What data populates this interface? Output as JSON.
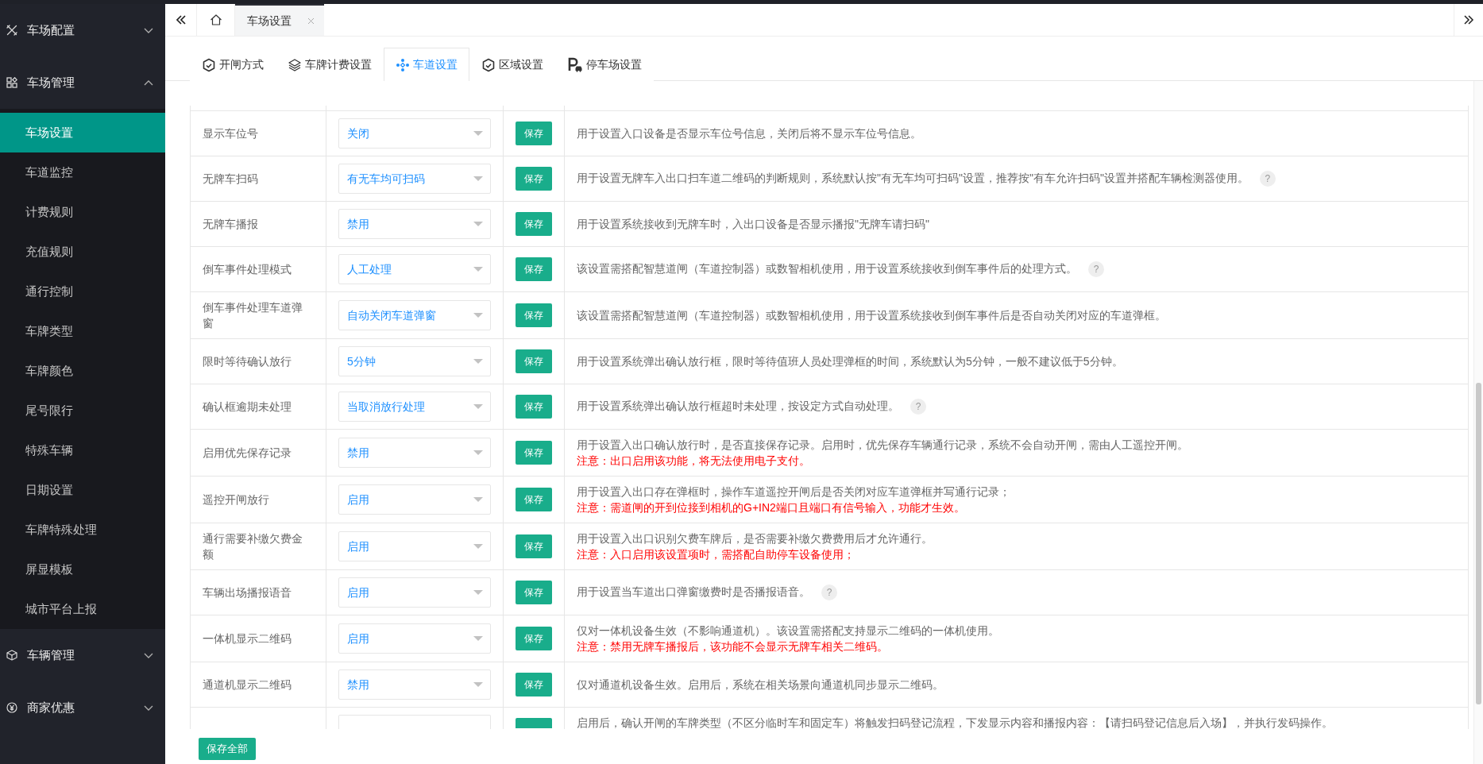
{
  "sidebar": {
    "items": [
      {
        "label": "车场配置",
        "expanded": false
      },
      {
        "label": "车场管理",
        "expanded": true,
        "children": [
          {
            "label": "车场设置",
            "selected": true
          },
          {
            "label": "车道监控",
            "selected": false
          },
          {
            "label": "计费规则",
            "selected": false
          },
          {
            "label": "充值规则",
            "selected": false
          },
          {
            "label": "通行控制",
            "selected": false
          },
          {
            "label": "车牌类型",
            "selected": false
          },
          {
            "label": "车牌颜色",
            "selected": false
          },
          {
            "label": "尾号限行",
            "selected": false
          },
          {
            "label": "特殊车辆",
            "selected": false
          },
          {
            "label": "日期设置",
            "selected": false
          },
          {
            "label": "车牌特殊处理",
            "selected": false
          },
          {
            "label": "屏显模板",
            "selected": false
          },
          {
            "label": "城市平台上报",
            "selected": false
          }
        ]
      },
      {
        "label": "车辆管理",
        "expanded": false
      },
      {
        "label": "商家优惠",
        "expanded": false
      }
    ]
  },
  "tab_bar": {
    "tabs": [
      {
        "label": "车场设置",
        "selected": true
      }
    ]
  },
  "page_tabs": [
    {
      "label": "开闸方式",
      "selected": false
    },
    {
      "label": "车牌计费设置",
      "selected": false
    },
    {
      "label": "车道设置",
      "selected": true
    },
    {
      "label": "区域设置",
      "selected": false
    },
    {
      "label": "停车场设置",
      "selected": false
    }
  ],
  "settings": {
    "rows": [
      {
        "kind": "setting",
        "label": "显示车位号",
        "value": "关闭",
        "button": "保存",
        "description": "用于设置入口设备是否显示车位号信息，关闭后将不显示车位号信息。"
      },
      {
        "kind": "setting",
        "label": "无牌车扫码",
        "value": "有无车均可扫码",
        "button": "保存",
        "description": "用于设置无牌车入出口扫车道二维码的判断规则，系统默认按\"有无车均可扫码\"设置，推荐按\"有车允许扫码\"设置并搭配车辆检测器使用。",
        "help": "?"
      },
      {
        "kind": "setting",
        "label": "无牌车播报",
        "value": "禁用",
        "button": "保存",
        "description": "用于设置系统接收到无牌车时，入出口设备是否显示播报\"无牌车请扫码\""
      },
      {
        "kind": "setting",
        "label": "倒车事件处理模式",
        "value": "人工处理",
        "button": "保存",
        "description": "该设置需搭配智慧道闸（车道控制器）或数智相机使用，用于设置系统接收到倒车事件后的处理方式。",
        "help": "?"
      },
      {
        "kind": "setting",
        "label": "倒车事件处理车道弹窗",
        "value": "自动关闭车道弹窗",
        "button": "保存",
        "description": "该设置需搭配智慧道闸（车道控制器）或数智相机使用，用于设置系统接收到倒车事件后是否自动关闭对应的车道弹框。"
      },
      {
        "kind": "setting",
        "label": "限时等待确认放行",
        "value": "5分钟",
        "button": "保存",
        "description": "用于设置系统弹出确认放行框，限时等待值班人员处理弹框的时间，系统默认为5分钟，一般不建议低于5分钟。"
      },
      {
        "kind": "setting",
        "label": "确认框逾期未处理",
        "value": "当取消放行处理",
        "button": "保存",
        "description": "用于设置系统弹出确认放行框超时未处理，按设定方式自动处理。",
        "help": "?"
      },
      {
        "kind": "setting",
        "label": "启用优先保存记录",
        "value": "禁用",
        "button": "保存",
        "description": "用于设置入出口确认放行时，是否直接保存记录。启用时，优先保存车辆通行记录，系统不会自动开闸，需由人工遥控开闸。",
        "note": "注意：出口启用该功能，将无法使用电子支付。"
      },
      {
        "kind": "setting",
        "label": "遥控开闸放行",
        "value": "启用",
        "button": "保存",
        "description": "用于设置入出口存在弹框时，操作车道遥控开闸后是否关闭对应车道弹框并写通行记录；",
        "note": "注意：需道闸的开到位接到相机的G+IN2端口且端口有信号输入，功能才生效。"
      },
      {
        "kind": "setting",
        "label": "通行需要补缴欠费金额",
        "value": "启用",
        "button": "保存",
        "description": "用于设置入出口识别欠费车牌后，是否需要补缴欠费费用后才允许通行。",
        "note": "注意：入口启用该设置项时，需搭配自助停车设备使用；"
      },
      {
        "kind": "setting",
        "label": "车辆出场播报语音",
        "value": "启用",
        "button": "保存",
        "description": "用于设置当车道出口弹窗缴费时是否播报语音。",
        "help": "?"
      },
      {
        "kind": "setting",
        "label": "一体机显示二维码",
        "value": "启用",
        "button": "保存",
        "description": "仅对一体机设备生效（不影响通道机）。该设置需搭配支持显示二维码的一体机使用。",
        "note": "注意：禁用无牌车播报后，该功能不会显示无牌车相关二维码。"
      },
      {
        "kind": "setting",
        "label": "通道机显示二维码",
        "value": "禁用",
        "button": "保存",
        "description": "仅对通道机设备生效。启用后，系统在相关场景向通道机同步显示二维码。"
      },
      {
        "kind": "clipped",
        "description": "启用后，确认开闸的车牌类型（不区分临时车和固定车）将触发扫码登记流程，下发显示内容和播报内容：【请扫码登记信息后入场】，并执行发码操作。"
      }
    ]
  },
  "save_all_button": "保存全部"
}
